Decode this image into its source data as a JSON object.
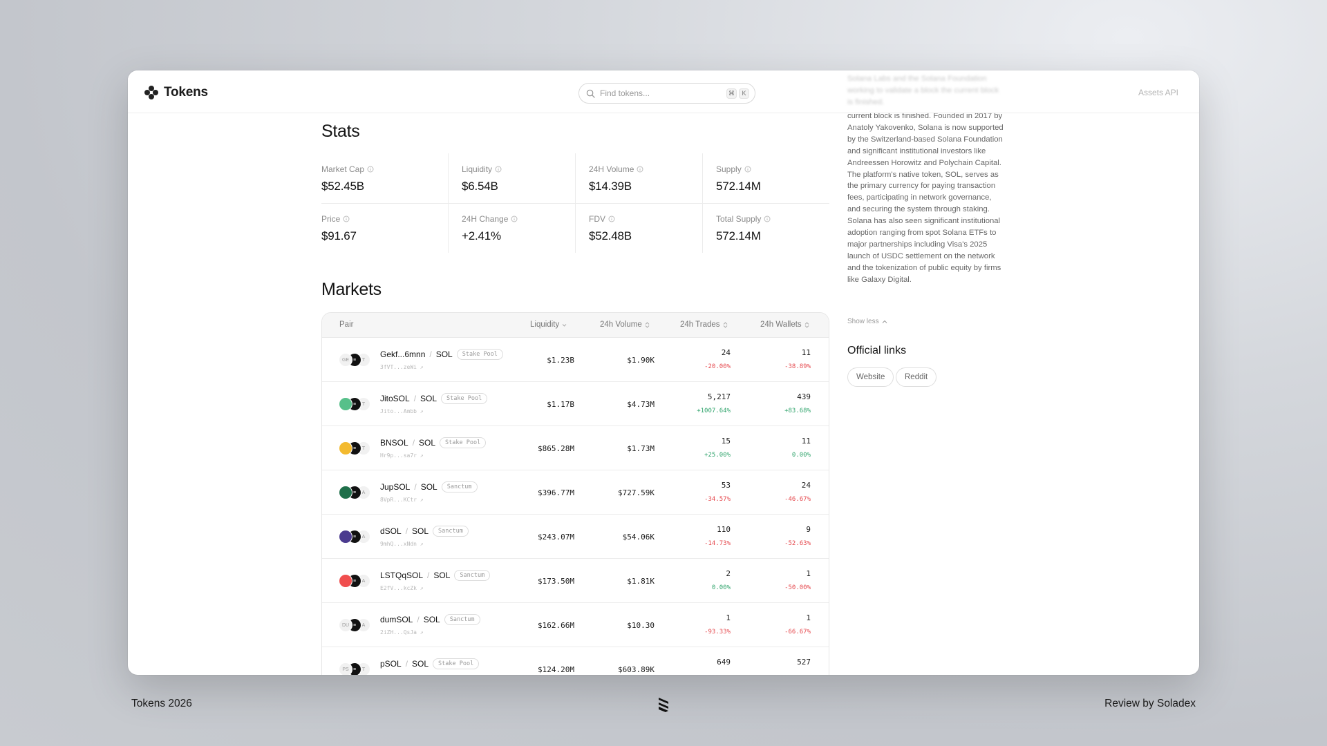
{
  "header": {
    "brand": "Tokens",
    "search_placeholder": "Find tokens...",
    "shortcut_keys": [
      "⌘",
      "K"
    ],
    "right_link": "Assets API"
  },
  "stats": {
    "title": "Stats",
    "items": [
      {
        "label": "Market Cap",
        "value": "$52.45B"
      },
      {
        "label": "Liquidity",
        "value": "$6.54B"
      },
      {
        "label": "24H Volume",
        "value": "$14.39B"
      },
      {
        "label": "Supply",
        "value": "572.14M"
      },
      {
        "label": "Price",
        "value": "$91.67"
      },
      {
        "label": "24H Change",
        "value": "+2.41%"
      },
      {
        "label": "FDV",
        "value": "$52.48B"
      },
      {
        "label": "Total Supply",
        "value": "572.14M"
      }
    ]
  },
  "markets": {
    "title": "Markets",
    "columns": {
      "pair": "Pair",
      "liquidity": "Liquidity",
      "volume": "24h Volume",
      "trades": "24h Trades",
      "wallets": "24h Wallets"
    },
    "rows": [
      {
        "base": "Gekf...6mnn",
        "quote": "SOL",
        "tag": "Stake Pool",
        "address": "3fVT...zeWi ↗",
        "liquidity": "$1.23B",
        "volume": "$1.90K",
        "trades": "24",
        "trades_change": "-20.00%",
        "trades_dir": "neg",
        "wallets": "11",
        "wallets_change": "-38.89%",
        "wallets_dir": "neg",
        "logo_text": "GE",
        "logo_color": "#f1f1f1",
        "side_text": "T"
      },
      {
        "base": "JitoSOL",
        "quote": "SOL",
        "tag": "Stake Pool",
        "address": "Jito...Ambb ↗",
        "liquidity": "$1.17B",
        "volume": "$4.73M",
        "trades": "5,217",
        "trades_change": "+1007.64%",
        "trades_dir": "pos",
        "wallets": "439",
        "wallets_change": "+83.68%",
        "wallets_dir": "pos",
        "logo_text": "",
        "logo_color": "#57c08a",
        "side_text": "T"
      },
      {
        "base": "BNSOL",
        "quote": "SOL",
        "tag": "Stake Pool",
        "address": "Hr9p...sa7r ↗",
        "liquidity": "$865.28M",
        "volume": "$1.73M",
        "trades": "15",
        "trades_change": "+25.00%",
        "trades_dir": "pos",
        "wallets": "11",
        "wallets_change": "0.00%",
        "wallets_dir": "pos",
        "logo_text": "",
        "logo_color": "#f3ba2f",
        "side_text": "T"
      },
      {
        "base": "JupSOL",
        "quote": "SOL",
        "tag": "Sanctum",
        "address": "8VpR...KCtr ↗",
        "liquidity": "$396.77M",
        "volume": "$727.59K",
        "trades": "53",
        "trades_change": "-34.57%",
        "trades_dir": "neg",
        "wallets": "24",
        "wallets_change": "-46.67%",
        "wallets_dir": "neg",
        "logo_text": "",
        "logo_color": "#1f6f4a",
        "side_text": "A"
      },
      {
        "base": "dSOL",
        "quote": "SOL",
        "tag": "Sanctum",
        "address": "9mhQ...xNdn ↗",
        "liquidity": "$243.07M",
        "volume": "$54.06K",
        "trades": "110",
        "trades_change": "-14.73%",
        "trades_dir": "neg",
        "wallets": "9",
        "wallets_change": "-52.63%",
        "wallets_dir": "neg",
        "logo_text": "",
        "logo_color": "#4b3b8f",
        "side_text": "A"
      },
      {
        "base": "LSTQqSOL",
        "quote": "SOL",
        "tag": "Sanctum",
        "address": "E2fV...kcZk ↗",
        "liquidity": "$173.50M",
        "volume": "$1.81K",
        "trades": "2",
        "trades_change": "0.00%",
        "trades_dir": "pos",
        "wallets": "1",
        "wallets_change": "-50.00%",
        "wallets_dir": "neg",
        "logo_text": "",
        "logo_color": "#f04e4e",
        "side_text": "A"
      },
      {
        "base": "dumSOL",
        "quote": "SOL",
        "tag": "Sanctum",
        "address": "2iZH...QsJa ↗",
        "liquidity": "$162.66M",
        "volume": "$10.30",
        "trades": "1",
        "trades_change": "-93.33%",
        "trades_dir": "neg",
        "wallets": "1",
        "wallets_change": "-66.67%",
        "wallets_dir": "neg",
        "logo_text": "DU",
        "logo_color": "#f1f1f1",
        "side_text": "A"
      },
      {
        "base": "pSOL",
        "quote": "SOL",
        "tag": "Stake Pool",
        "address": "",
        "liquidity": "$124.20M",
        "volume": "$603.89K",
        "trades": "649",
        "trades_change": "",
        "trades_dir": "pos",
        "wallets": "527",
        "wallets_change": "",
        "wallets_dir": "pos",
        "logo_text": "PS",
        "logo_color": "#f1f1f1",
        "side_text": "T"
      }
    ]
  },
  "about": {
    "faded_lines": "Solana Labs and the Solana Foundation working to validate a block the current block is finished.",
    "text": "current block is finished. Founded in 2017 by Anatoly Yakovenko, Solana is now supported by the Switzerland-based Solana Foundation and significant institutional investors like Andreessen Horowitz and Polychain Capital. The platform's native token, SOL, serves as the primary currency for paying transaction fees, participating in network governance, and securing the system through staking. Solana has also seen significant institutional adoption ranging from spot Solana ETFs to major partnerships including Visa's 2025 launch of USDC settlement on the network and the tokenization of public equity by firms like Galaxy Digital.",
    "show_less": "Show less"
  },
  "official_links": {
    "title": "Official links",
    "items": [
      "Website",
      "Reddit"
    ]
  },
  "footer": {
    "left": "Tokens 2026",
    "right": "Review by Soladex"
  },
  "colors": {
    "negative": "#e5484d",
    "positive": "#30a46c"
  }
}
